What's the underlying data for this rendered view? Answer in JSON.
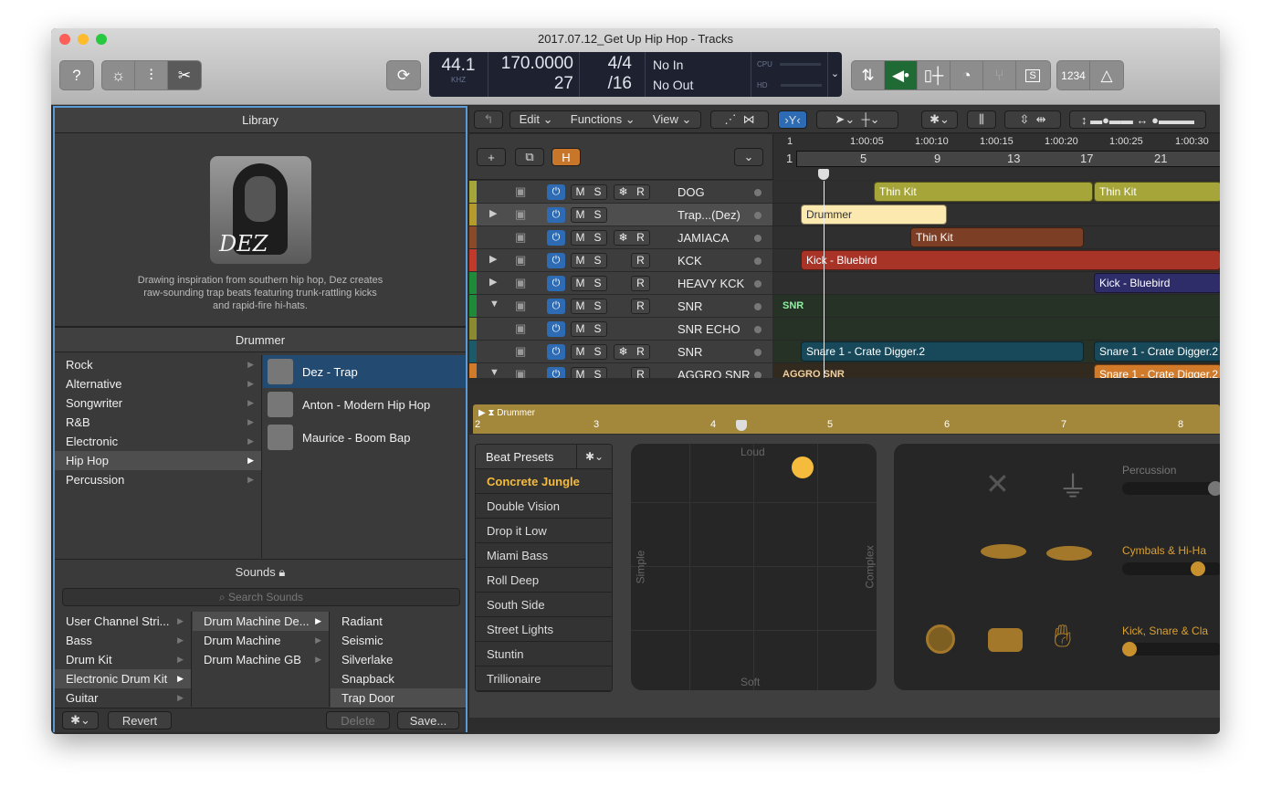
{
  "window": {
    "title": "2017.07.12_Get Up Hip Hop - Tracks"
  },
  "toolbar": {
    "left_buttons": [
      {
        "name": "help-button",
        "icon": "question-icon"
      },
      {
        "name": "smart-controls-button",
        "icon": "knob-icon"
      },
      {
        "name": "mixer-button",
        "icon": "sliders-icon"
      },
      {
        "name": "editors-button",
        "icon": "scissors-icon"
      }
    ],
    "cycle_icon": "cycle-icon",
    "lcd": {
      "sample_rate": "44.1",
      "sample_rate_unit": "KHZ",
      "tempo": "170.0000",
      "key_or_bar": "27",
      "signature": "4/4",
      "division": "/16",
      "input": "No In",
      "output": "No Out",
      "cpu_label": "CPU",
      "hd_label": "HD"
    },
    "right_buttons": [
      {
        "name": "bounce-button",
        "icon": "bounce-icon"
      },
      {
        "name": "speaker-button",
        "icon": "speaker-icon",
        "active": true
      },
      {
        "name": "fader-button",
        "icon": "fader-icon"
      },
      {
        "name": "meter-button",
        "icon": "gauge-icon"
      },
      {
        "name": "tuner-button",
        "icon": "tuning-fork-icon"
      },
      {
        "name": "solo-button",
        "label": "S"
      }
    ],
    "countin_label": "1234",
    "metronome_icon": "metronome-icon"
  },
  "library": {
    "title": "Library",
    "drummer_name": "DEZ",
    "description": "Drawing inspiration from southern hip hop, Dez creates raw-sounding trap beats featuring trunk-rattling kicks and rapid-fire hi-hats.",
    "drummer_section": "Drummer",
    "genres": [
      "Rock",
      "Alternative",
      "Songwriter",
      "R&B",
      "Electronic",
      "Hip Hop",
      "Percussion"
    ],
    "selected_genre": "Hip Hop",
    "drummers": [
      "Dez - Trap",
      "Anton - Modern Hip Hop",
      "Maurice - Boom Bap"
    ],
    "selected_drummer": "Dez - Trap",
    "sounds_title": "Sounds",
    "search_placeholder": "Search Sounds",
    "sound_col1": [
      "User Channel Stri...",
      "Bass",
      "Drum Kit",
      "Electronic Drum Kit",
      "Guitar"
    ],
    "sound_col2": [
      "Drum Machine De...",
      "Drum Machine",
      "Drum Machine GB"
    ],
    "sound_col3": [
      "Radiant",
      "Seismic",
      "Silverlake",
      "Snapback",
      "Trap Door"
    ],
    "revert_label": "Revert",
    "delete_label": "Delete",
    "save_label": "Save..."
  },
  "tracks_toolbar": {
    "edit": "Edit",
    "functions": "Functions",
    "view": "View"
  },
  "ruler": {
    "times": [
      "1",
      "1:00:05",
      "1:00:10",
      "1:00:15",
      "1:00:20",
      "1:00:25",
      "1:00:30"
    ],
    "bars": [
      "1",
      "5",
      "9",
      "13",
      "17",
      "21"
    ]
  },
  "track_header": {
    "add": "+",
    "h_label": "H"
  },
  "tracks": [
    {
      "name": "DOG",
      "color": "#a5a53a",
      "freeze": true,
      "rec": true,
      "disclosure": ""
    },
    {
      "name": "Trap...(Dez)",
      "color": "#b59a2c",
      "freeze": false,
      "rec": false,
      "disclosure": "▶",
      "selected": true
    },
    {
      "name": "JAMIACA",
      "color": "#8a4a2a",
      "freeze": true,
      "rec": true,
      "disclosure": ""
    },
    {
      "name": "KCK",
      "color": "#c0392b",
      "freeze": false,
      "rec": true,
      "disclosure": "▶"
    },
    {
      "name": "HEAVY KCK",
      "color": "#1f8a3a",
      "freeze": false,
      "rec": true,
      "disclosure": "▶"
    },
    {
      "name": "SNR",
      "color": "#1f8a3a",
      "freeze": false,
      "rec": true,
      "disclosure": "▼"
    },
    {
      "name": "SNR ECHO",
      "color": "#8a8a30",
      "freeze": false,
      "rec": false,
      "disclosure": ""
    },
    {
      "name": "SNR",
      "color": "#1a5a6a",
      "freeze": true,
      "rec": true,
      "disclosure": ""
    },
    {
      "name": "AGGRO SNR",
      "color": "#d07a2a",
      "freeze": false,
      "rec": true,
      "disclosure": "▼"
    }
  ],
  "regions": {
    "thin_kit_1": "Thin Kit",
    "thin_kit_2": "Thin Kit",
    "drummer": "Drummer",
    "thin_kit_3": "Thin Kit",
    "kick_1": "Kick - Bluebird",
    "kick_2": "Kick - Bluebird",
    "snr_folder": "SNR",
    "snare_1": "Snare 1 - Crate Digger.2",
    "snare_2": "Snare 1 - Crate Digger.2",
    "aggro_folder": "AGGRO SNR",
    "snare_3": "Snare 1 - Crate Digger.2"
  },
  "drummer_editor": {
    "region_label": "Drummer",
    "bars": [
      "2",
      "3",
      "4",
      "5",
      "6",
      "7",
      "8"
    ],
    "beat_presets_label": "Beat Presets",
    "presets": [
      "Concrete Jungle",
      "Double Vision",
      "Drop it Low",
      "Miami Bass",
      "Roll Deep",
      "South Side",
      "Street Lights",
      "Stuntin",
      "Trillionaire"
    ],
    "selected_preset": "Concrete Jungle",
    "xy": {
      "top": "Loud",
      "bottom": "Soft",
      "left": "Simple",
      "right": "Complex",
      "complexity": 0.7,
      "loudness": 0.95
    },
    "sliders": [
      {
        "label": "Percussion",
        "value": 1.0,
        "active": false
      },
      {
        "label": "Cymbals & Hi-Ha",
        "value": 0.8,
        "active": true
      },
      {
        "label": "Kick, Snare & Cla",
        "value": 0.0,
        "active": true
      }
    ]
  }
}
